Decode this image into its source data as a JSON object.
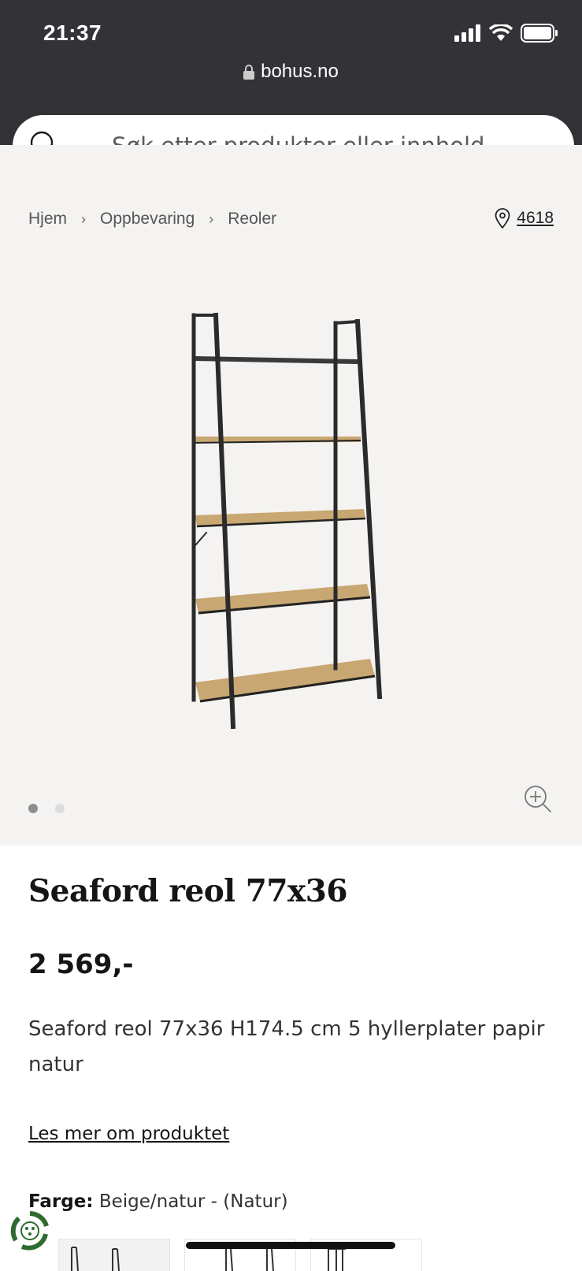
{
  "status_bar": {
    "time": "21:37"
  },
  "browser": {
    "url": "bohus.no"
  },
  "search": {
    "placeholder": "Søk etter produkter eller innhold..."
  },
  "breadcrumb": {
    "items": [
      "Hjem",
      "Oppbevaring",
      "Reoler"
    ],
    "separator": "›"
  },
  "store": {
    "icon": "location-pin-icon",
    "number": "4618"
  },
  "gallery": {
    "image_count": 2,
    "active_index": 0
  },
  "product": {
    "title": "Seaford reol 77x36",
    "price": "2 569,-",
    "description": "Seaford reol 77x36 H174.5 cm 5 hyllerplater papir natur",
    "read_more": "Les mer om produktet",
    "color_label": "Farge:",
    "color_value": "Beige/natur - (Natur)"
  },
  "colors": {
    "topbar": "#333237",
    "gallery_bg": "#f4f3f1",
    "text": "#151515"
  }
}
